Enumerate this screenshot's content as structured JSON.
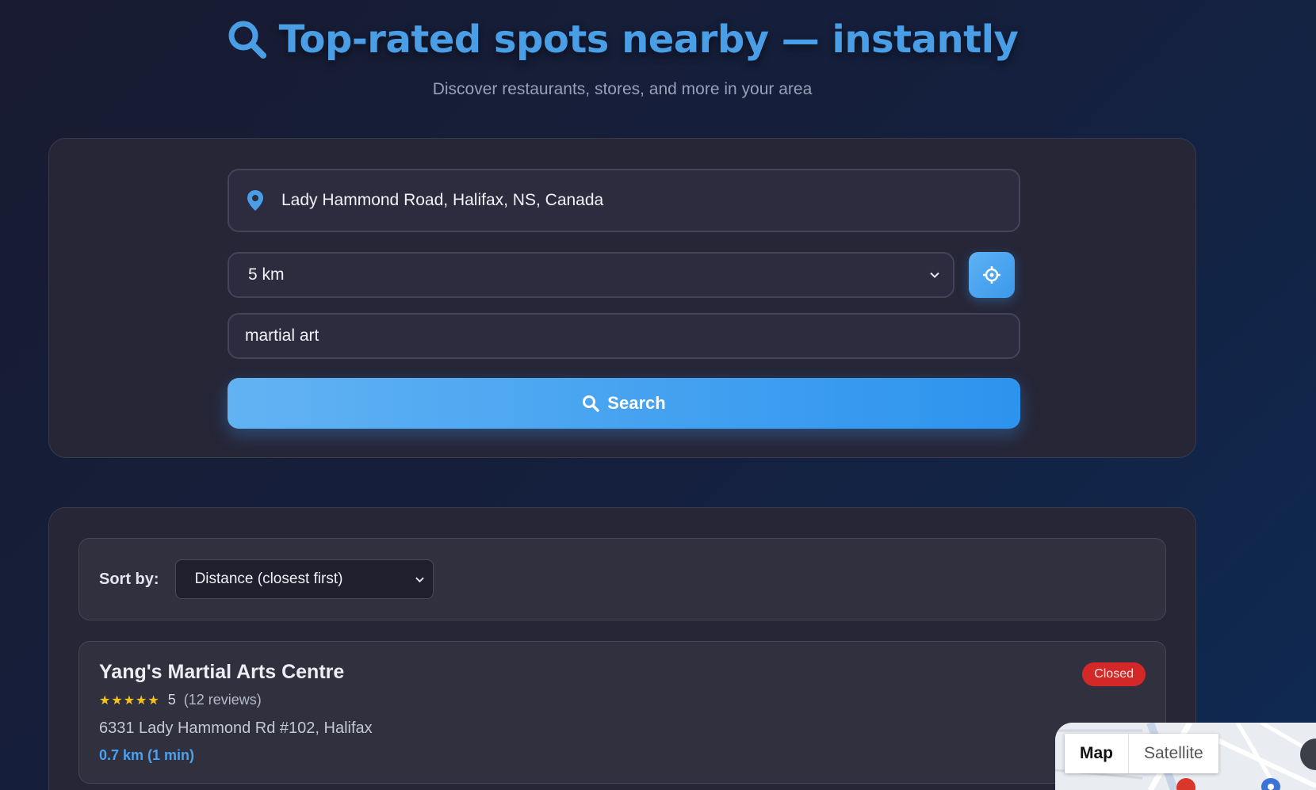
{
  "header": {
    "title": "Top-rated spots nearby — instantly",
    "subtitle": "Discover restaurants, stores, and more in your area"
  },
  "search": {
    "location_value": "Lady Hammond Road, Halifax, NS, Canada",
    "radius_selected": "5 km",
    "keyword_value": "martial art",
    "search_label": "Search"
  },
  "results": {
    "sort_label": "Sort by:",
    "sort_selected": "Distance (closest first)",
    "items": [
      {
        "name": "Yang's Martial Arts Centre",
        "stars": "★★★★★",
        "rating": "5",
        "reviews": "(12 reviews)",
        "address": "6331 Lady Hammond Rd #102, Halifax",
        "distance": "0.7 km (1 min)",
        "status": "Closed"
      }
    ]
  },
  "map": {
    "tab_map": "Map",
    "tab_satellite": "Satellite"
  },
  "colors": {
    "accent": "#4a9ee6",
    "button_start": "#62b3f3",
    "button_end": "#2c93ee",
    "closed_badge": "#d42727",
    "star": "#f4c21b"
  },
  "icons": {
    "title_icon": "search-icon",
    "location_icon": "map-pin-icon",
    "locate_icon": "crosshair-icon",
    "search_button_icon": "search-icon",
    "select_icon": "chevron-down-icon"
  }
}
